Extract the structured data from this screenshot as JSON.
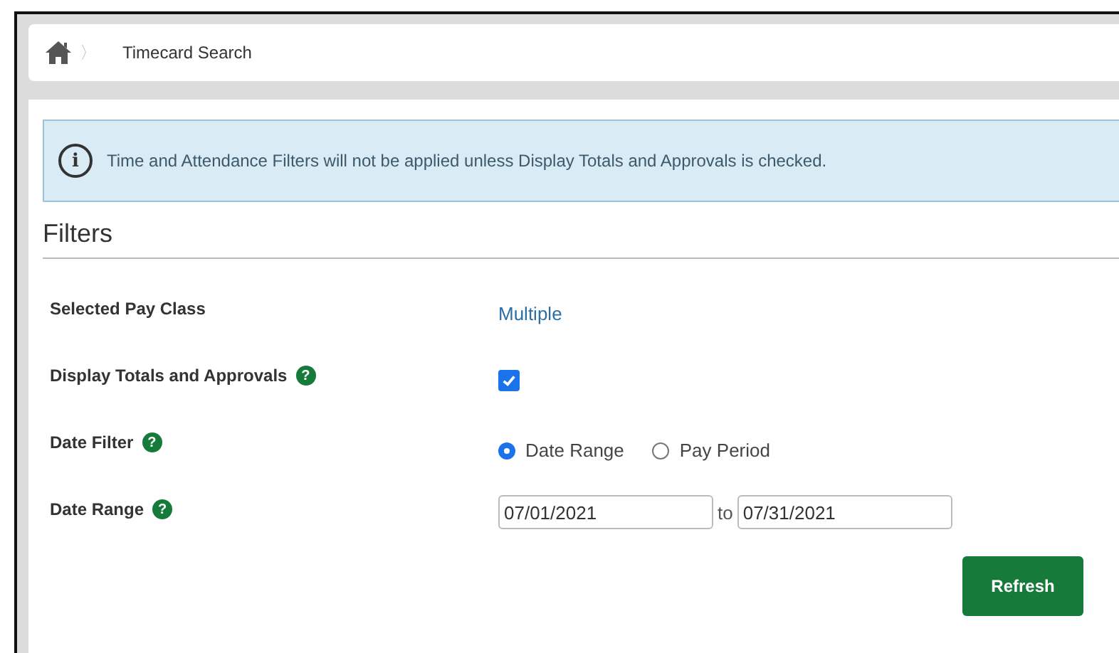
{
  "breadcrumb": {
    "separator": "〉",
    "current": "Timecard Search"
  },
  "alert": {
    "icon": "i",
    "message": "Time and Attendance Filters will not be applied unless Display Totals and Approvals is checked."
  },
  "section": {
    "title": "Filters"
  },
  "rows": [
    {
      "kind": "text",
      "label": "Selected Pay Class",
      "value": "Multiple"
    },
    {
      "kind": "checkbox",
      "label": "Display Totals and Approvals",
      "help": "?",
      "checked": true
    },
    {
      "kind": "radio",
      "label": "Date Filter",
      "help": "?",
      "options": [
        {
          "label": "Date Range",
          "selected": true
        },
        {
          "label": "Pay Period",
          "selected": false
        }
      ]
    },
    {
      "kind": "daterange",
      "label": "Date Range",
      "help": "?",
      "from": "07/01/2021",
      "joiner": "to",
      "to": "07/31/2021"
    }
  ],
  "button": {
    "label": "Refresh"
  }
}
